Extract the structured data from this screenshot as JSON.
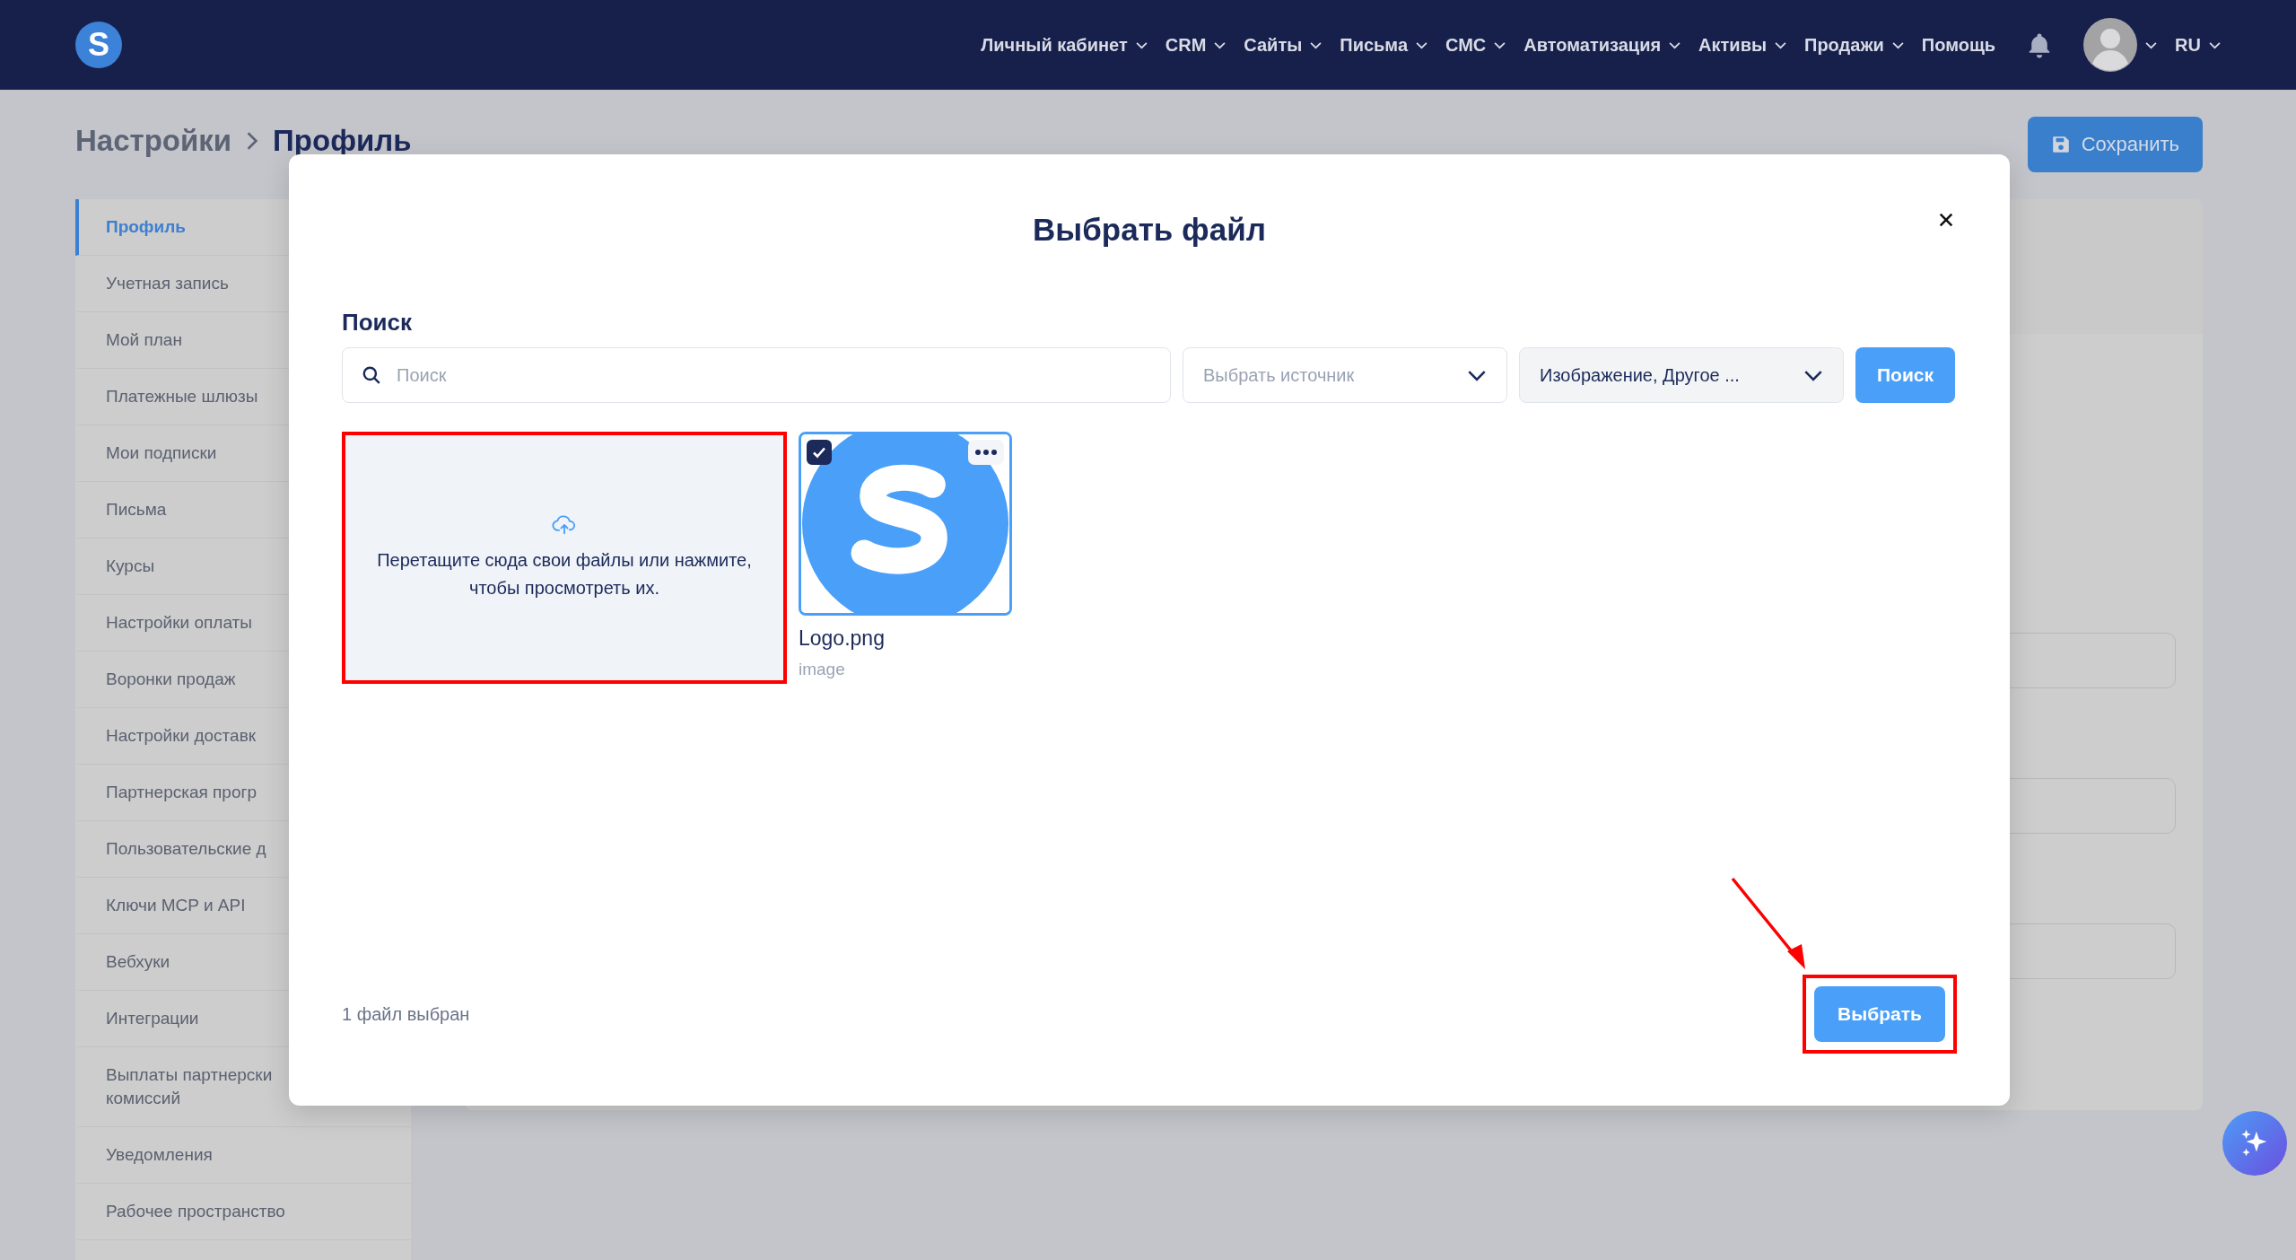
{
  "nav": {
    "brand_mark": "S",
    "items": [
      {
        "label": "Личный кабинет",
        "dropdown": true
      },
      {
        "label": "CRM",
        "dropdown": true
      },
      {
        "label": "Сайты",
        "dropdown": true
      },
      {
        "label": "Письма",
        "dropdown": true
      },
      {
        "label": "СМС",
        "dropdown": true
      },
      {
        "label": "Автоматизация",
        "dropdown": true
      },
      {
        "label": "Активы",
        "dropdown": true
      },
      {
        "label": "Продажи",
        "dropdown": true
      },
      {
        "label": "Помощь",
        "dropdown": false
      }
    ],
    "language": "RU"
  },
  "breadcrumb": [
    "Настройки",
    "Профиль"
  ],
  "save_button": "Сохранить",
  "sidebar": {
    "items": [
      {
        "label": "Профиль",
        "selected": true
      },
      {
        "label": "Учетная запись",
        "selected": false
      },
      {
        "label": "Мой план",
        "selected": false
      },
      {
        "label": "Платежные шлюзы",
        "selected": false
      },
      {
        "label": "Мои подписки",
        "selected": false
      },
      {
        "label": "Письма",
        "selected": false
      },
      {
        "label": "Курсы",
        "selected": false
      },
      {
        "label": "Настройки оплаты",
        "selected": false
      },
      {
        "label": "Воронки продаж",
        "selected": false
      },
      {
        "label": "Настройки доставк",
        "selected": false
      },
      {
        "label": "Партнерская прогр",
        "selected": false
      },
      {
        "label": "Пользовательские д",
        "selected": false
      },
      {
        "label": "Ключи MCP и API",
        "selected": false
      },
      {
        "label": "Вебхуки",
        "selected": false
      },
      {
        "label": "Интеграции",
        "selected": false
      },
      {
        "label": "Выплаты партнерски комиссий",
        "selected": false
      },
      {
        "label": "Уведомления",
        "selected": false
      },
      {
        "label": "Рабочее пространство",
        "selected": false
      }
    ]
  },
  "dialog": {
    "title": "Выбрать файл",
    "search_label": "Поиск",
    "search": {
      "placeholder": "Поиск"
    },
    "source_select": {
      "placeholder": "Выбрать источник"
    },
    "type_select": {
      "value": "Изображение, Другое ..."
    },
    "search_button": "Поиск",
    "upload_zone": {
      "text": "Перетащите сюда свои файлы или нажмите, чтобы просмотреть их.",
      "highlighted": true
    },
    "files": [
      {
        "name": "Logo.png",
        "type": "image",
        "selected": true
      }
    ],
    "selection_count": "1 файл выбран",
    "select_button": {
      "label": "Выбрать",
      "highlighted": true,
      "pointer_arrow": true
    }
  }
}
